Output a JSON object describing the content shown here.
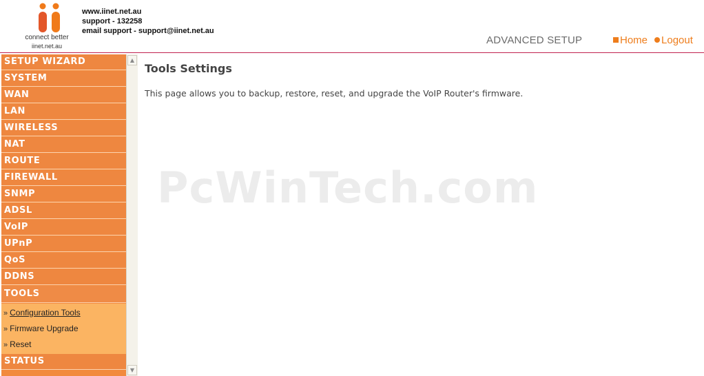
{
  "header": {
    "logo_tagline": "connect better",
    "logo_site": "iinet.net.au",
    "contact": {
      "website": "www.iinet.net.au",
      "support": "support - 132258",
      "email": "email support - support@iinet.net.au"
    },
    "section_title": "ADVANCED SETUP",
    "links": {
      "home": "Home",
      "logout": "Logout"
    }
  },
  "sidebar": {
    "items": [
      {
        "label": "SETUP WIZARD"
      },
      {
        "label": "SYSTEM"
      },
      {
        "label": "WAN"
      },
      {
        "label": "LAN"
      },
      {
        "label": "WIRELESS"
      },
      {
        "label": "NAT"
      },
      {
        "label": "ROUTE"
      },
      {
        "label": "FIREWALL"
      },
      {
        "label": "SNMP"
      },
      {
        "label": "ADSL"
      },
      {
        "label": "VoIP"
      },
      {
        "label": "UPnP"
      },
      {
        "label": "QoS"
      },
      {
        "label": "DDNS"
      },
      {
        "label": "TOOLS"
      },
      {
        "label": "STATUS"
      }
    ],
    "tools_submenu": [
      {
        "label": "Configuration Tools"
      },
      {
        "label": "Firmware Upgrade"
      },
      {
        "label": "Reset"
      }
    ],
    "submenu_prefix": "»"
  },
  "main": {
    "title": "Tools Settings",
    "description": "This page allows you to backup, restore, reset, and upgrade the VoIP Router's firmware."
  },
  "watermark": "PcWinTech.com",
  "colors": {
    "accent": "#ee7d1c",
    "menu": "#ee8740",
    "submenu": "#fbb462",
    "rule": "#c0204e"
  }
}
